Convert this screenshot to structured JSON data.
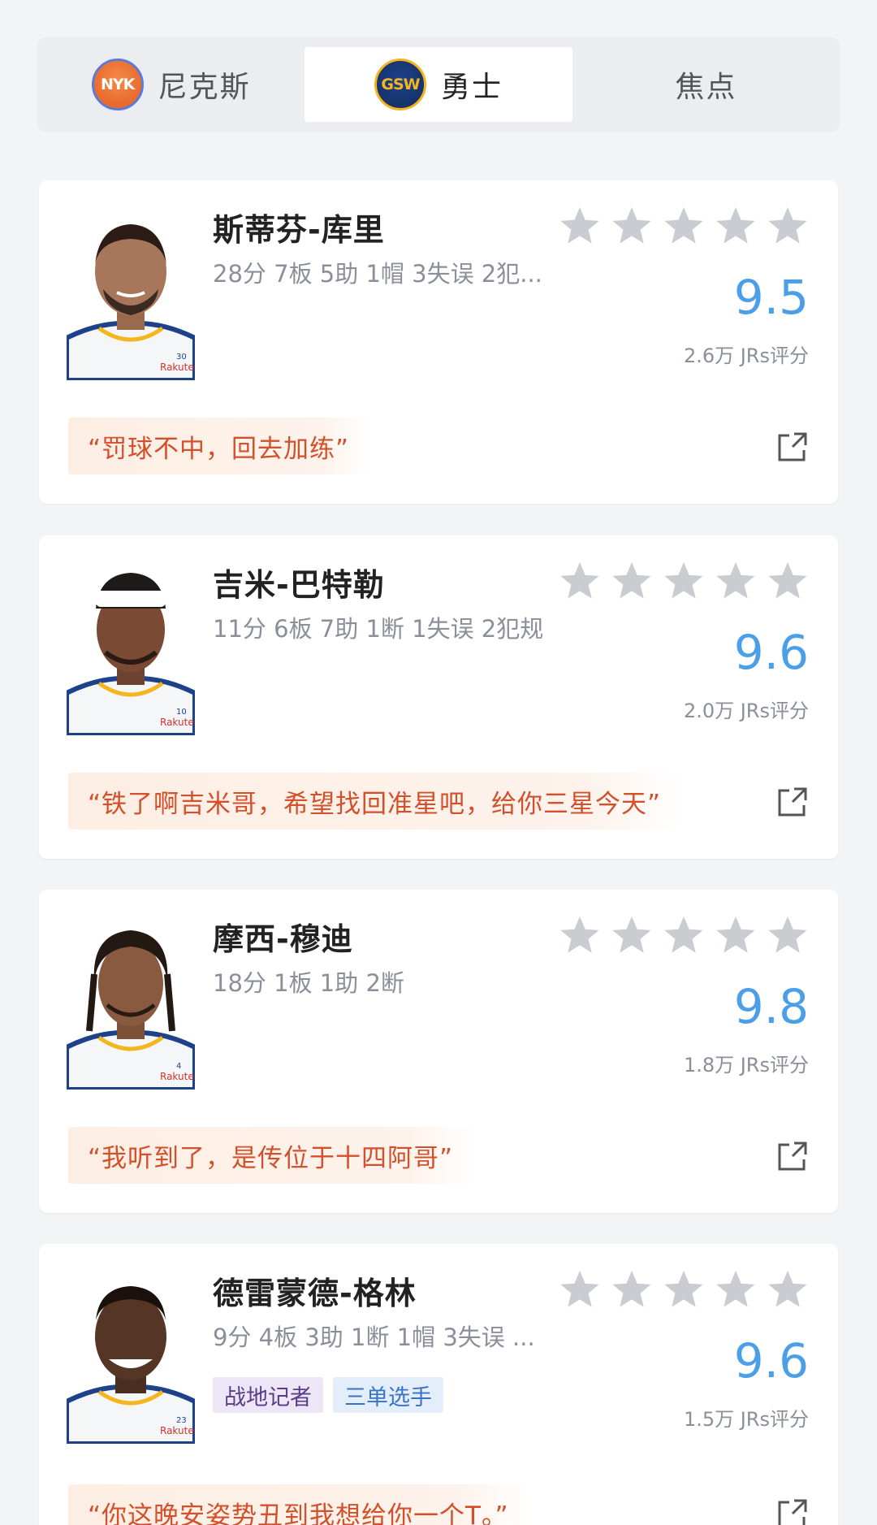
{
  "tabs": [
    {
      "label": "尼克斯",
      "logo": "NYK"
    },
    {
      "label": "勇士",
      "logo": "GSW"
    },
    {
      "label": "焦点"
    }
  ],
  "active_tab": 1,
  "colors": {
    "score": "#4a9fe8",
    "quote_text": "#d3502a",
    "star": "#c9ccd1"
  },
  "players": [
    {
      "name": "斯蒂芬-库里",
      "stats": "28分 7板 5助 1帽 3失误 2犯...",
      "score": "9.5",
      "votes": "2.6万 JRs评分",
      "quote": "“罚球不中，回去加练”",
      "jersey_number": "30",
      "tags": []
    },
    {
      "name": "吉米-巴特勒",
      "stats": "11分 6板 7助 1断 1失误 2犯规",
      "score": "9.6",
      "votes": "2.0万 JRs评分",
      "quote": "“铁了啊吉米哥，希望找回准星吧，给你三星今天”",
      "jersey_number": "10",
      "tags": []
    },
    {
      "name": "摩西-穆迪",
      "stats": "18分 1板 1助 2断",
      "score": "9.8",
      "votes": "1.8万 JRs评分",
      "quote": "“我听到了，是传位于十四阿哥”",
      "jersey_number": "4",
      "tags": []
    },
    {
      "name": "德雷蒙德-格林",
      "stats": "9分 4板 3助 1断 1帽 3失误 ...",
      "score": "9.6",
      "votes": "1.5万 JRs评分",
      "quote": "“你这晚安姿势丑到我想给你一个T。”",
      "jersey_number": "23",
      "tags": [
        "战地记者",
        "三单选手"
      ]
    }
  ],
  "jersey_sponsor": "Rakuten"
}
